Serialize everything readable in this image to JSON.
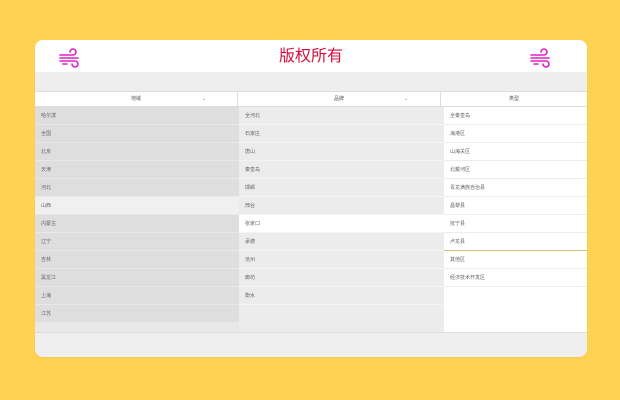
{
  "header": {
    "title": "版权所有",
    "icon_color": "#e020c8",
    "title_color": "#d40f3c"
  },
  "selects": [
    {
      "label": "地域"
    },
    {
      "label": "品牌"
    },
    {
      "label": "类型"
    }
  ],
  "lists": {
    "provinces": [
      "哈尔滨",
      "全国",
      "北京",
      "天津",
      "河北",
      "山西",
      "内蒙古",
      "辽宁",
      "吉林",
      "黑龙江",
      "上海",
      "江苏"
    ],
    "cities": [
      "全河北",
      "石家庄",
      "唐山",
      "秦皇岛",
      "邯郸",
      "邢台",
      "张家口",
      "承德",
      "沧州",
      "廊坊",
      "衡水"
    ],
    "districts": [
      "全秦皇岛",
      "海港区",
      "山海关区",
      "北戴河区",
      "青龙满族自治县",
      "昌黎县",
      "抚宁县",
      "卢龙县",
      "其他区",
      "经济技术开发区"
    ]
  },
  "active": {
    "provinces": 5,
    "cities": 6,
    "districts": 7
  },
  "colors": {
    "background": "#ffd252",
    "accent_line": "#c9c27a"
  }
}
